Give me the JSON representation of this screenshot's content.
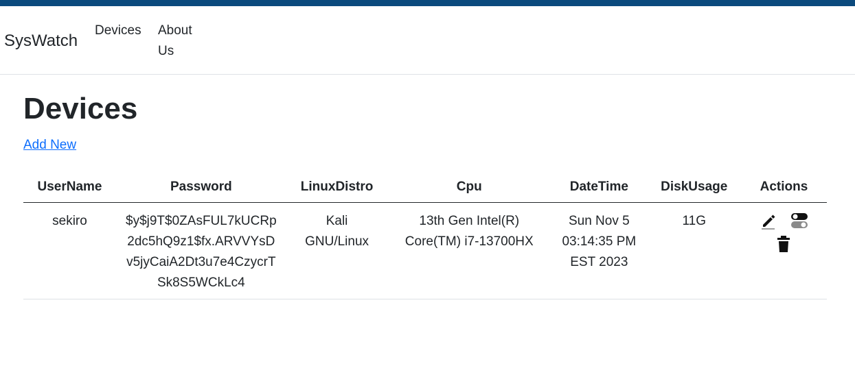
{
  "navbar": {
    "brand": "SysWatch",
    "links": [
      {
        "label": "Devices"
      },
      {
        "label": "About Us"
      }
    ]
  },
  "page": {
    "title": "Devices",
    "add_new_label": "Add New"
  },
  "table": {
    "headers": [
      "UserName",
      "Password",
      "LinuxDistro",
      "Cpu",
      "DateTime",
      "DiskUsage",
      "Actions"
    ],
    "rows": [
      {
        "username": "sekiro",
        "password": "$y$j9T$0ZAsFUL7kUCRp2dc5hQ9z1$fx.ARVVYsDv5jyCaiA2Dt3u7e4CzycrTSk8S5WCkLc4",
        "linux_distro": "Kali GNU/Linux",
        "cpu": "13th Gen Intel(R) Core(TM) i7-13700HX",
        "datetime": "Sun Nov 5 03:14:35 PM EST 2023",
        "disk_usage": "11G",
        "actions": [
          {
            "icon": "pencil-icon"
          },
          {
            "icon": "toggle-icon"
          },
          {
            "icon": "trash-icon"
          }
        ]
      }
    ]
  }
}
